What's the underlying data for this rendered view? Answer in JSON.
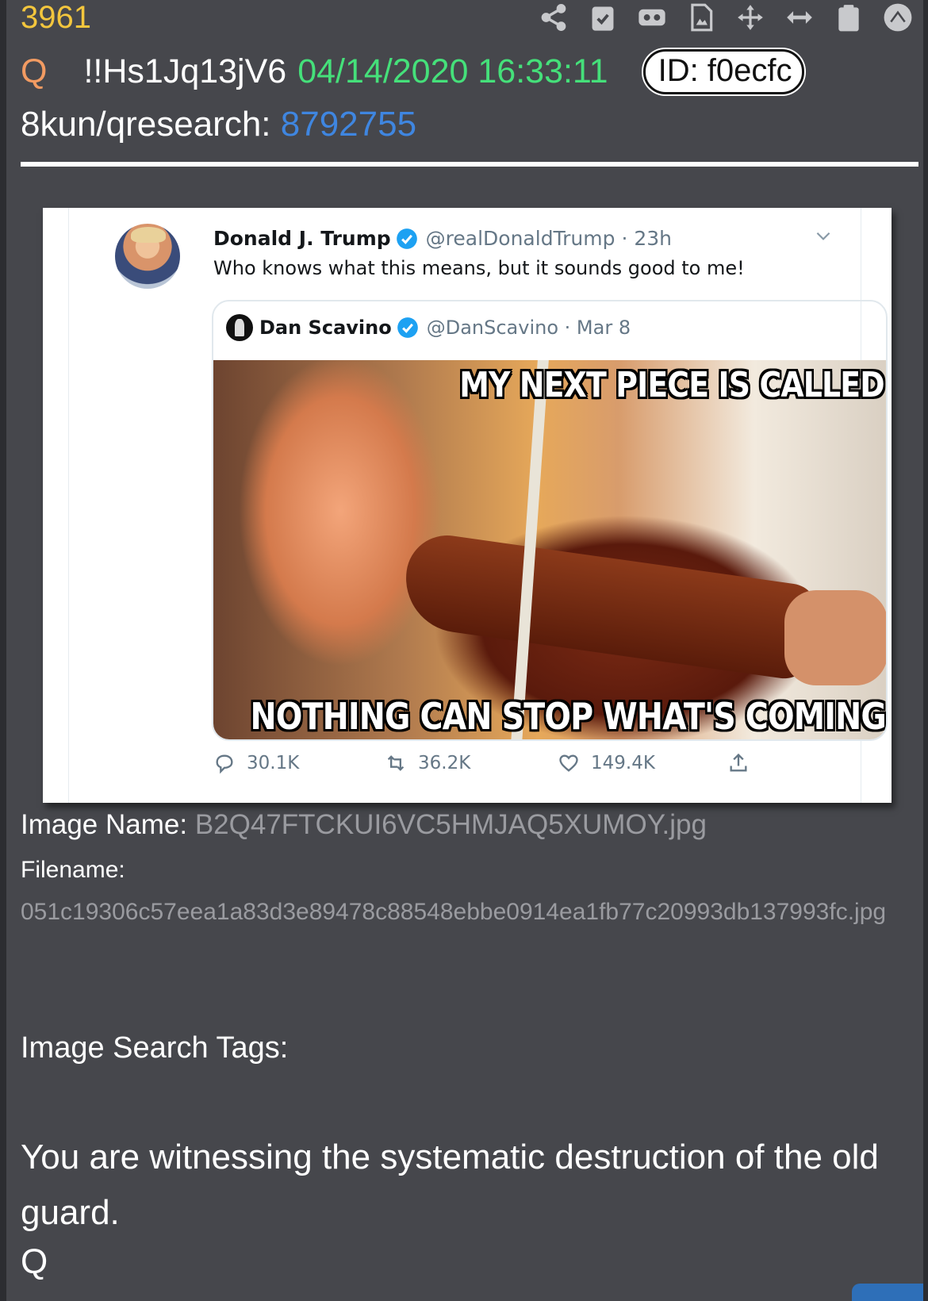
{
  "post": {
    "number": "3961",
    "q_label": "Q",
    "tripcode": "!!Hs1Jq13jV6",
    "timestamp": "04/14/2020 16:33:11",
    "id_badge": "ID: f0ecfc",
    "board": "8kun/qresearch:",
    "thread_link": "8792755"
  },
  "toolbar": {
    "icons": [
      "share-icon",
      "clipboard-check-icon",
      "vr-headset-icon",
      "image-file-icon",
      "move-arrows-icon",
      "horizontal-arrows-icon",
      "clipboard-icon",
      "caret-up-icon"
    ]
  },
  "tweet": {
    "author_name": "Donald J. Trump",
    "author_handle": "@realDonaldTrump · 23h",
    "text": "Who knows what this means, but it sounds good to me!",
    "quoted": {
      "author_name": "Dan Scavino",
      "author_handle": "@DanScavino · Mar 8",
      "meme_top_text": "MY NEXT PIECE IS CALLED",
      "meme_bottom_text": "NOTHING CAN STOP WHAT'S COMING"
    },
    "replies": "30.1K",
    "retweets": "36.2K",
    "likes": "149.4K",
    "verified_color": "#1da1f2"
  },
  "attachment": {
    "image_name_label": "Image Name:",
    "image_name": "B2Q47FTCKUI6VC5HMJAQ5XUMOY.jpg",
    "filename_label": "Filename:",
    "filename": "051c19306c57eea1a83d3e89478c88548ebbe0914ea1fb77c20993db137993fc.jpg",
    "search_tags_label": "Image Search Tags:"
  },
  "message": {
    "body": "You are witnessing the systematic destruction of the old guard.",
    "signature": "Q"
  }
}
